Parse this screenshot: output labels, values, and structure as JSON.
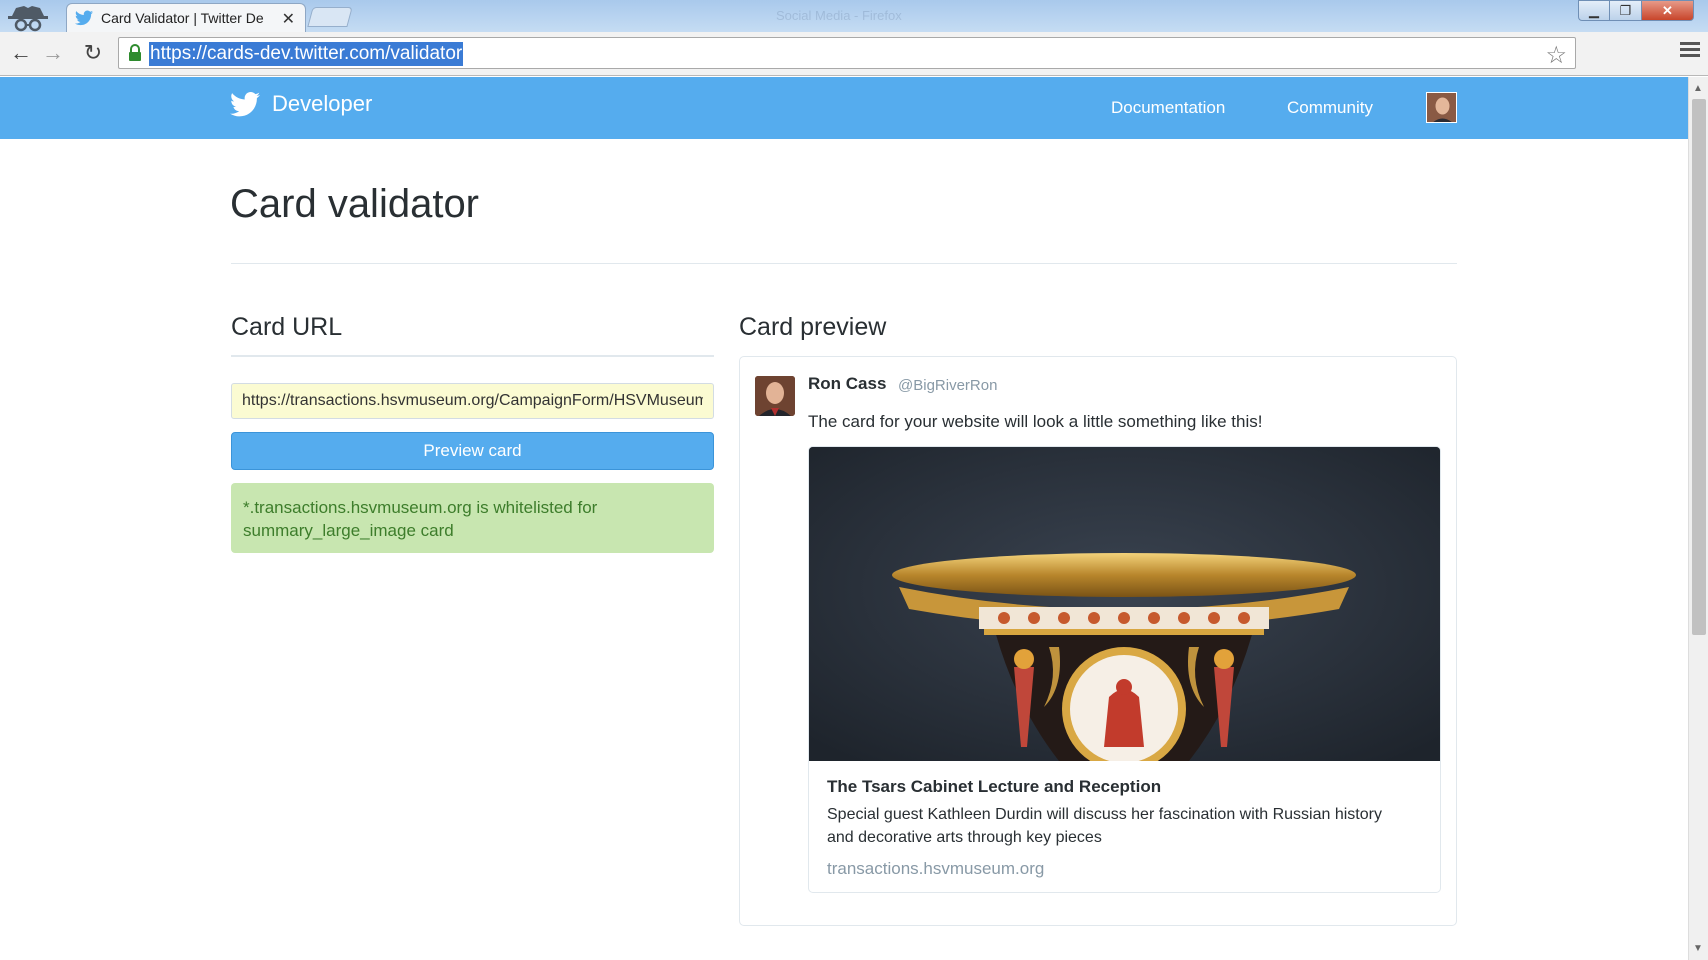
{
  "browser": {
    "tab_title": "Card Validator | Twitter De",
    "window_title": "Social Media - Firefox",
    "url": "https://cards-dev.twitter.com/validator",
    "icons": [
      "incognito-icon",
      "twitter-bird-icon",
      "close-icon",
      "back-icon",
      "forward-icon",
      "reload-icon",
      "lock-icon",
      "star-icon",
      "menu-icon"
    ]
  },
  "header": {
    "brand": "Developer",
    "nav": {
      "documentation": "Documentation",
      "community": "Community"
    },
    "color": "#55acee"
  },
  "page": {
    "title": "Card validator",
    "card_url": {
      "heading": "Card URL",
      "input_value": "https://transactions.hsvmuseum.org/CampaignForm/HSVMuseum",
      "button_label": "Preview card",
      "status_message": "*.transactions.hsvmuseum.org is whitelisted for summary_large_image card"
    },
    "card_preview": {
      "heading": "Card preview",
      "tweet": {
        "name": "Ron Cass",
        "handle": "@BigRiverRon",
        "text": "The card for your website will look a little something like this!"
      },
      "card": {
        "title": "The Tsars Cabinet Lecture and Reception",
        "description": "Special guest Kathleen Durdin will discuss her fascination with Russian history and decorative arts through key pieces",
        "domain": "transactions.hsvmuseum.org"
      }
    }
  },
  "colors": {
    "accent": "#55acee",
    "success_bg": "#c8e6b0",
    "success_text": "#3d7d2b",
    "input_bg": "#fbfbd2"
  }
}
